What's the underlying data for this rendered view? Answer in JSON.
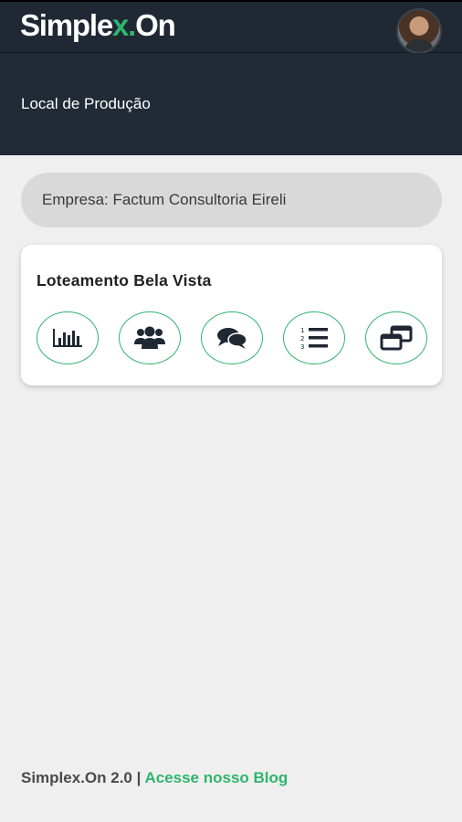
{
  "app": {
    "logo_prefix": "Simple",
    "logo_x": "x",
    "logo_dot": ".",
    "logo_suffix": "On",
    "accent_color": "#2fb46e",
    "header_color": "#1f2833"
  },
  "header": {
    "title": "Local de Produção"
  },
  "company": {
    "label": "Empresa: Factum Consultoria Eireli"
  },
  "project_card": {
    "title": "Loteamento Bela Vista",
    "actions": [
      {
        "icon": "bar-chart-icon"
      },
      {
        "icon": "users-icon"
      },
      {
        "icon": "chat-icon"
      },
      {
        "icon": "numbered-list-icon"
      },
      {
        "icon": "windows-icon"
      }
    ]
  },
  "footer": {
    "version": "Simplex.On 2.0 | ",
    "blog_link": "Acesse nosso Blog"
  }
}
